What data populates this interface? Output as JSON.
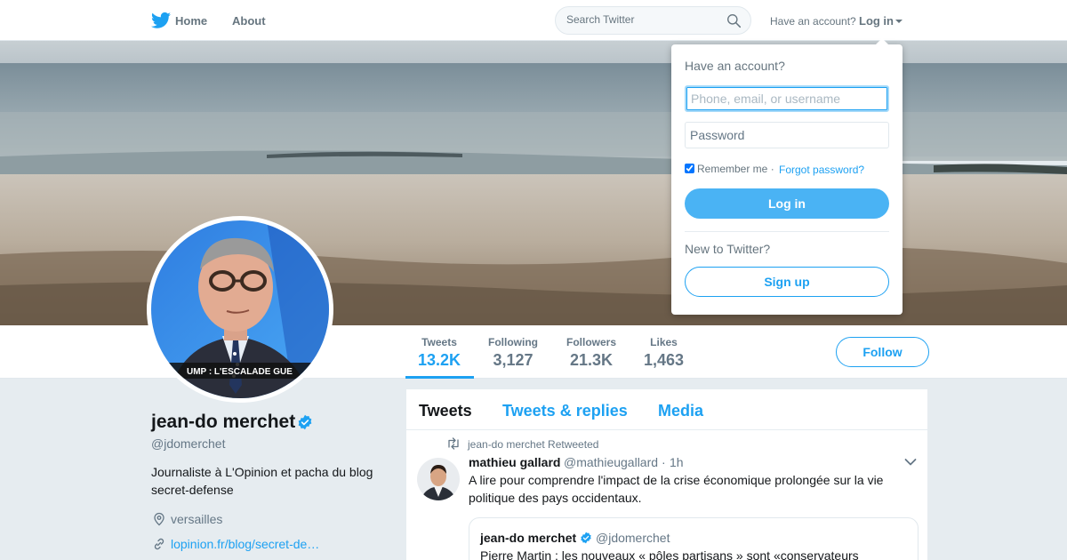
{
  "nav": {
    "home": "Home",
    "about": "About",
    "search_placeholder": "Search Twitter",
    "have_account": "Have an account?",
    "login": "Log in"
  },
  "profile": {
    "name": "jean-do merchet",
    "handle": "@jdomerchet",
    "bio": "Journaliste à L'Opinion et pacha du blog secret-defense",
    "location": "versailles",
    "link": "lopinion.fr/blog/secret-de…",
    "avatar_caption": "UMP : L'ESCALADE GUE"
  },
  "stats": [
    {
      "label": "Tweets",
      "value": "13.2K",
      "active": true
    },
    {
      "label": "Following",
      "value": "3,127",
      "active": false
    },
    {
      "label": "Followers",
      "value": "21.3K",
      "active": false
    },
    {
      "label": "Likes",
      "value": "1,463",
      "active": false
    }
  ],
  "follow_label": "Follow",
  "timeline": {
    "tabs": [
      "Tweets",
      "Tweets & replies",
      "Media"
    ],
    "retweet_context": "jean-do merchet Retweeted",
    "tweet": {
      "name": "mathieu gallard",
      "handle": "@mathieugallard",
      "separator": "·",
      "time": "1h",
      "text": "A lire pour comprendre l'impact de la crise économique prolongée sur la vie politique des pays occidentaux.",
      "quote": {
        "name": "jean-do merchet",
        "handle": "@jdomerchet",
        "text": "Pierre Martin : les nouveaux « pôles partisans » sont «conservateurs"
      }
    }
  },
  "login_dropdown": {
    "title": "Have an account?",
    "username_placeholder": "Phone, email, or username",
    "password_placeholder": "Password",
    "remember": "Remember me",
    "separator": "·",
    "forgot": "Forgot password?",
    "login_button": "Log in",
    "new_to": "New to Twitter?",
    "signup_button": "Sign up"
  },
  "colors": {
    "brand": "#1da1f2",
    "background": "#e6ecf0"
  }
}
